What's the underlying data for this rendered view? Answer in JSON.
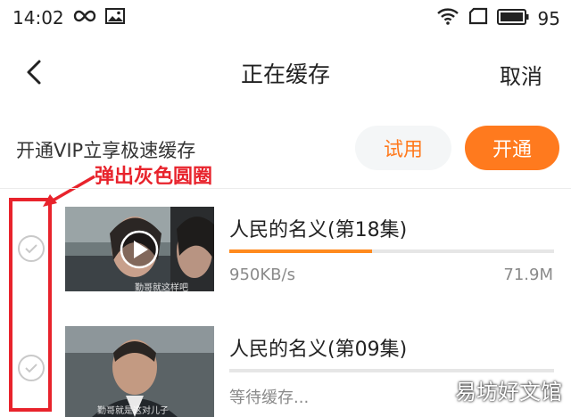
{
  "status_bar": {
    "time": "14:02",
    "battery": "95",
    "icons": [
      "infinity-icon",
      "image-icon",
      "wifi-icon",
      "sim-icon",
      "battery-icon"
    ]
  },
  "header": {
    "title": "正在缓存",
    "cancel_label": "取消",
    "back_icon": "chevron-left-icon"
  },
  "vip": {
    "text": "开通VIP立享极速缓存",
    "try_label": "试用",
    "open_label": "开通"
  },
  "annotation": "弹出灰色圆圈",
  "downloads": [
    {
      "title": "人民的名义(第18集)",
      "progress": 0.44,
      "status": "950KB/s",
      "size": "71.9M",
      "thumb_caption": "勤哥就这样吧"
    },
    {
      "title": "人民的名义(第09集)",
      "progress": 0,
      "status": "等待缓存...",
      "size": "",
      "thumb_caption": "勤哥就是这对儿子"
    }
  ],
  "watermark": "易坊好文馆",
  "colors": {
    "accent": "#ff7a1e",
    "annotation_red": "#e8232c",
    "muted": "#8a8a8a"
  }
}
